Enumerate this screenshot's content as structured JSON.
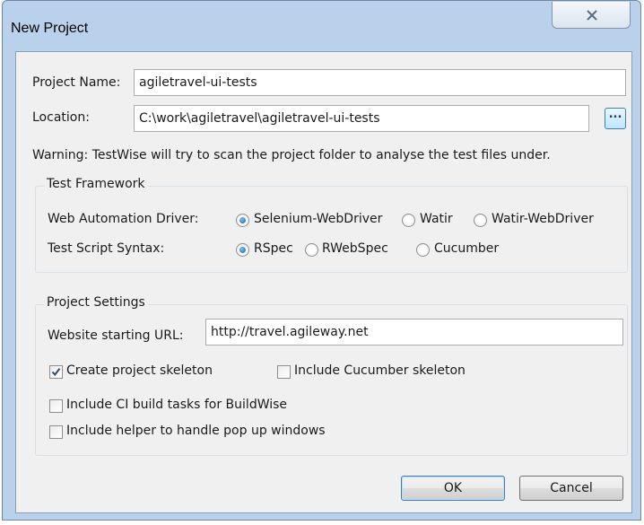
{
  "window": {
    "title": "New Project"
  },
  "project": {
    "name_label": "Project Name:",
    "name_value": "agiletravel-ui-tests",
    "location_label": "Location:",
    "location_value": "C:\\work\\agiletravel\\agiletravel-ui-tests",
    "browse_label": "...",
    "warning": "Warning: TestWise will try to scan the project folder to analyse the test files under."
  },
  "test_framework": {
    "title": "Test Framework",
    "driver_label": "Web Automation Driver:",
    "driver_options": [
      "Selenium-WebDriver",
      "Watir",
      "Watir-WebDriver"
    ],
    "driver_selected": "Selenium-WebDriver",
    "syntax_label": "Test Script Syntax:",
    "syntax_options": [
      "RSpec",
      "RWebSpec",
      "Cucumber"
    ],
    "syntax_selected": "RSpec"
  },
  "project_settings": {
    "title": "Project Settings",
    "url_label": "Website starting URL:",
    "url_value": "http://travel.agileway.net",
    "checkboxes": [
      {
        "label": "Create project skeleton",
        "checked": true
      },
      {
        "label": "Include Cucumber skeleton",
        "checked": false
      },
      {
        "label": "Include CI build tasks for BuildWise",
        "checked": false
      },
      {
        "label": "Include helper to handle pop up windows",
        "checked": false
      }
    ]
  },
  "buttons": {
    "ok": "OK",
    "cancel": "Cancel"
  },
  "colors": {
    "frame": "#b9d1ea",
    "client": "#f0f0f0",
    "accent": "#3c7fb1"
  }
}
